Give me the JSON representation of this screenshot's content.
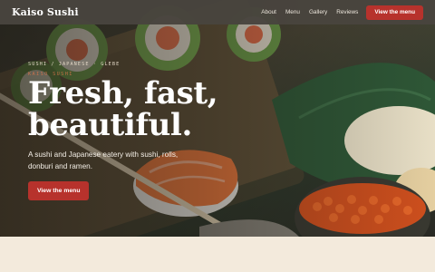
{
  "nav": {
    "brand": "Kaiso Sushi",
    "links": [
      "About",
      "Menu",
      "Gallery",
      "Reviews"
    ],
    "cta": "View the menu"
  },
  "hero": {
    "eyebrow": "SUSHI / JAPANESE · GLEBE",
    "eyebrow_sub": "KAISO SUSHI",
    "headline": "Fresh, fast, beautiful.",
    "lead": "A sushi and Japanese eatery with sushi, rolls, donburi and ramen.",
    "cta": "View the menu"
  },
  "colors": {
    "accent": "#b7322c",
    "nav_bg": "#48443e",
    "page_bg": "#f3eadc"
  }
}
